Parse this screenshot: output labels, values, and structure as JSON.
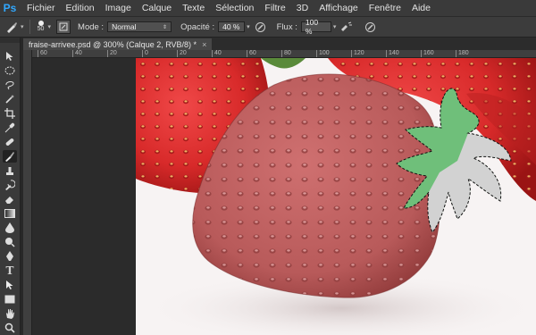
{
  "app": {
    "logo": "Ps"
  },
  "menu": [
    "Fichier",
    "Edition",
    "Image",
    "Calque",
    "Texte",
    "Sélection",
    "Filtre",
    "3D",
    "Affichage",
    "Fenêtre",
    "Aide"
  ],
  "options": {
    "brush_size": "50",
    "mode_label": "Mode :",
    "mode_value": "Normal",
    "opacity_label": "Opacité :",
    "opacity_value": "40 %",
    "flow_label": "Flux :",
    "flow_value": "100 %"
  },
  "document": {
    "tab_title": "fraise-arrivee.psd @ 300% (Calque 2, RVB/8) *",
    "tab_close": "×"
  },
  "ruler": {
    "top_labels": [
      "60",
      "40",
      "20",
      "0",
      "20",
      "40",
      "60",
      "80",
      "100",
      "120",
      "140",
      "160",
      "180"
    ]
  },
  "colors": {
    "accent": "#31a8ff",
    "overlay": "#c05050",
    "stem": "#6fbf7a"
  },
  "icons": [
    "brush-icon",
    "move-icon",
    "marquee-icon",
    "lasso-icon",
    "magic-wand-icon",
    "crop-icon",
    "eyedropper-icon",
    "healing-icon",
    "brush-tool-icon",
    "stamp-icon",
    "history-brush-icon",
    "eraser-icon",
    "gradient-icon",
    "blur-icon",
    "dodge-icon",
    "pen-icon",
    "type-icon",
    "path-select-icon",
    "shape-icon",
    "hand-icon",
    "zoom-icon"
  ]
}
